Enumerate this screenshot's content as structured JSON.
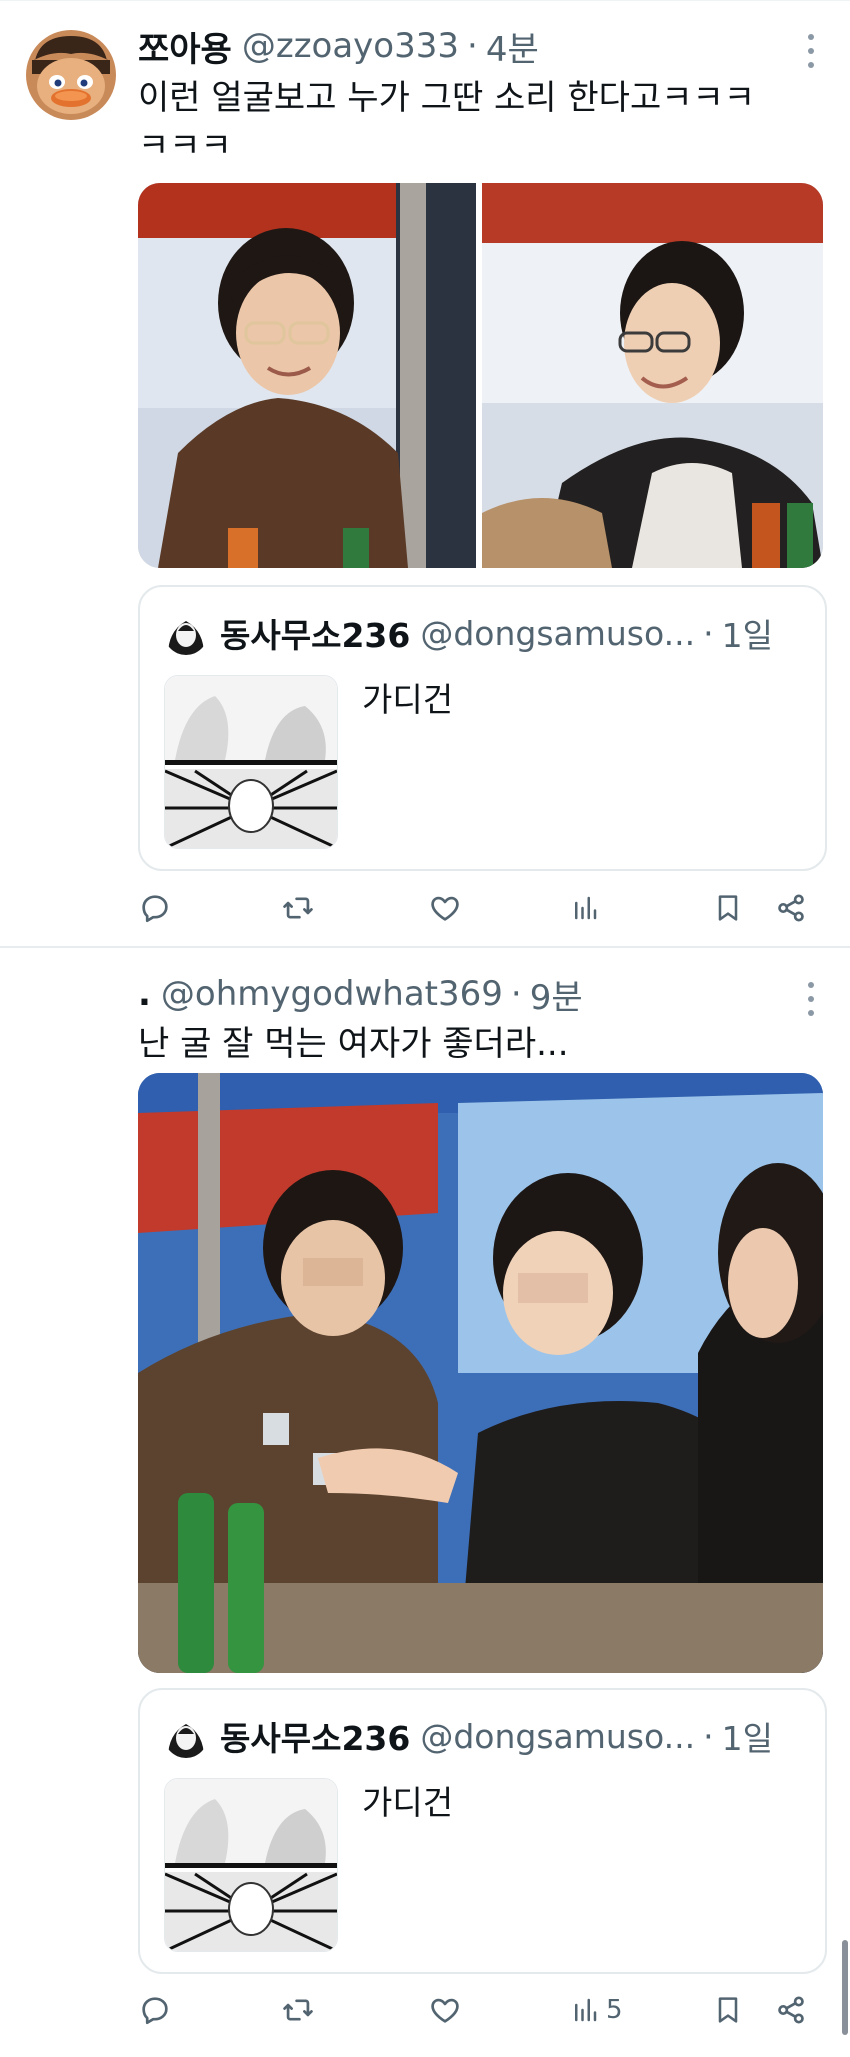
{
  "colors": {
    "text_primary": "#0f1419",
    "text_secondary": "#536471",
    "icon": "#536471",
    "divider": "#e8ecee",
    "card_border": "#e4e9ec"
  },
  "tweets": [
    {
      "author_name": "쪼아용",
      "handle": "@zzoayo333",
      "dot": "·",
      "time": "4분",
      "text_line1": "이런 얼굴보고 누가 그딴 소리 한다고ㅋㅋㅋ",
      "text_line2": "ㅋㅋㅋ",
      "avatar_icon": "cartoon-duck-avatar",
      "media": [
        {
          "description": "photo-woman-glasses-smiling-booth"
        },
        {
          "description": "photo-woman-glasses-laughing-booth"
        }
      ],
      "quote": {
        "author_name": "동사무소236",
        "handle": "@dongsamuso...",
        "dot": "·",
        "time": "1일",
        "text": "가디건",
        "thumbnail_icon": "manga-panel-thumbnail"
      },
      "actions": {
        "reply_icon": "reply-icon",
        "retweet_icon": "retweet-icon",
        "like_icon": "heart-icon",
        "views_icon": "views-bar-icon",
        "views_count": "",
        "bookmark_icon": "bookmark-icon",
        "share_icon": "share-icon"
      }
    },
    {
      "author_name": ".",
      "handle": "@ohmygodwhat369",
      "dot": "·",
      "time": "9분",
      "text_line1": "난 굴 잘 먹는 여자가 좋더라...",
      "media": [
        {
          "description": "photo-three-women-toasting-soju"
        }
      ],
      "quote": {
        "author_name": "동사무소236",
        "handle": "@dongsamuso...",
        "dot": "·",
        "time": "1일",
        "text": "가디건",
        "thumbnail_icon": "manga-panel-thumbnail"
      },
      "actions": {
        "reply_icon": "reply-icon",
        "retweet_icon": "retweet-icon",
        "like_icon": "heart-icon",
        "views_icon": "views-bar-icon",
        "views_count": "5",
        "bookmark_icon": "bookmark-icon",
        "share_icon": "share-icon"
      }
    }
  ]
}
